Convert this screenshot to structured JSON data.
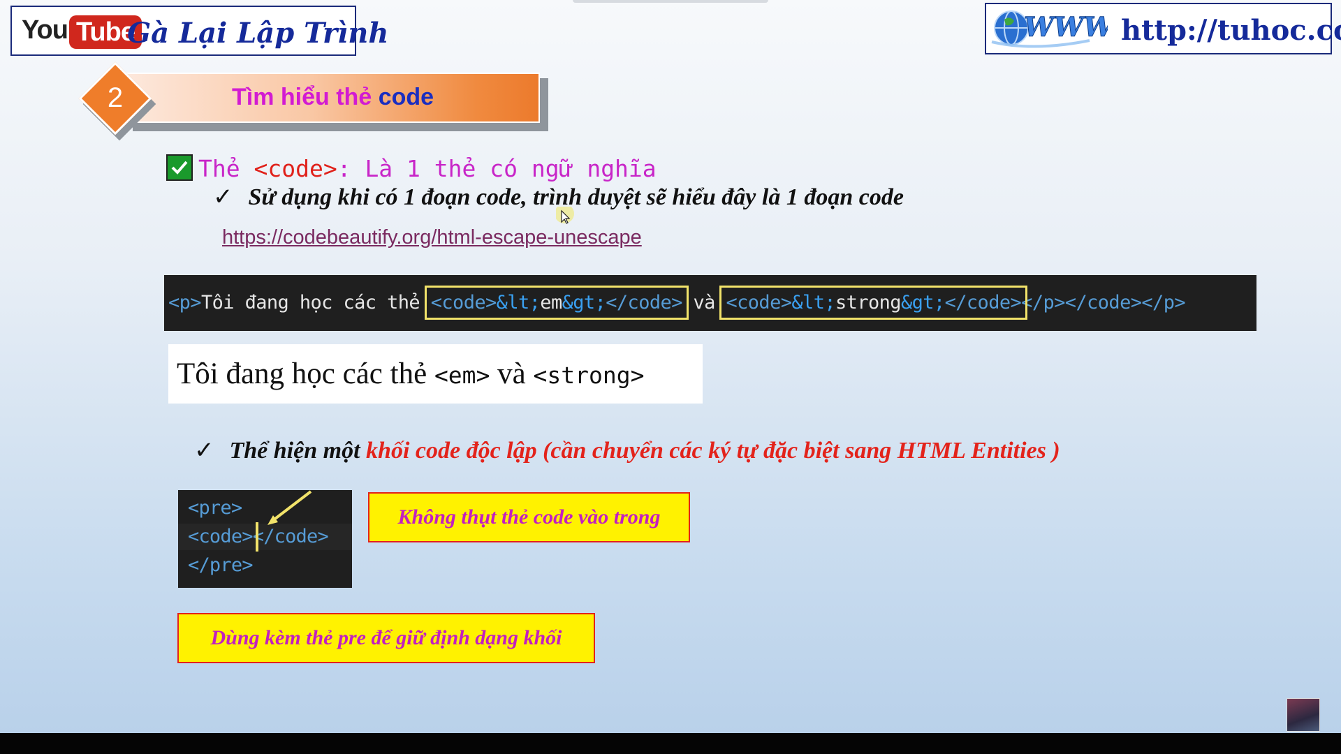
{
  "header": {
    "yt_you": "You",
    "yt_tube": "Tube",
    "channel_name": "Gà Lại Lập Trình",
    "url_icon": "www-globe-icon",
    "site_url": "http://tuhoc.cc"
  },
  "section": {
    "number": "2",
    "title_prefix": "Tìm hiểu thẻ",
    "title_code": "code"
  },
  "heading": {
    "prefix": "Thẻ ",
    "tag": "<code>",
    "suffix": ": Là 1 thẻ có ngữ nghĩa"
  },
  "bullet1": {
    "tick": "✓",
    "text": "Sử dụng khi có 1 đoạn code, trình duyệt sẽ hiểu đây là 1 đoạn code"
  },
  "link": "https://codebeautify.org/html-escape-unescape",
  "code_example": {
    "p_open": "<p>",
    "text1": "Tôi đang học các thẻ ",
    "code1": {
      "open": "<code>",
      "ent_lt": "&lt;",
      "word": "em",
      "ent_gt": "&gt;",
      "close": "</code>"
    },
    "text2": " và ",
    "code2": {
      "open": "<code>",
      "ent_lt": "&lt;",
      "word": "strong",
      "ent_gt": "&gt;",
      "close": "</code>"
    },
    "tail": "</p></code></p>"
  },
  "rendered": {
    "text1": "Tôi đang học các thẻ ",
    "em": "<em>",
    "text2": " và ",
    "strong": "<strong>"
  },
  "bullet2": {
    "tick": "✓",
    "black": "Thể hiện một ",
    "red": "khối code độc lập (cần chuyển các ký tự đặc biệt sang HTML Entities )"
  },
  "code_block": {
    "line1": "<pre>",
    "line2_open": "<code>",
    "line2_close": "</code>",
    "line3": "</pre>"
  },
  "notes": {
    "note1": "Không thụt thẻ code vào trong",
    "note2": "Dùng kèm thẻ pre để giữ định dạng khối"
  },
  "colors": {
    "accent_orange": "#ef7d2a",
    "heading_magenta": "#c825c8",
    "red": "#e3231b",
    "note_yellow": "#fff200",
    "navy": "#152a9a"
  }
}
